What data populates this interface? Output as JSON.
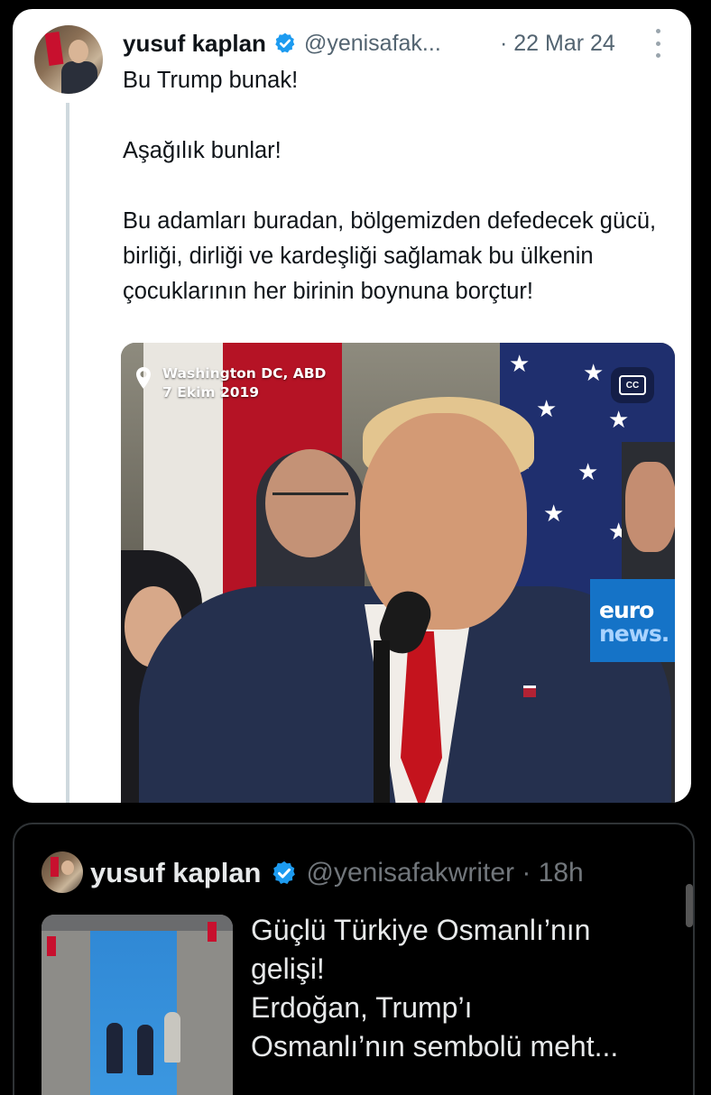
{
  "tweet": {
    "author_name": "yusuf kaplan",
    "handle": "@yenisafak...",
    "timestamp": "· 22 Mar 24",
    "paragraphs": [
      "Bu Trump bunak!",
      "Aşağılık bunlar!",
      "Bu adamları buradan, bölgemizden defedecek gücü, birliği, dirliği ve kardeşliği sağlamak bu ülkenin çocuklarının her birinin boynuna borçtur!"
    ],
    "video": {
      "location": "Washington DC, ABD",
      "date": "7 Ekim 2019",
      "cc_label": "CC",
      "logo_line1": "euro",
      "logo_line2": "news."
    }
  },
  "quoted": {
    "author_name": "yusuf kaplan",
    "handle": "@yenisafakwriter · 18h",
    "lines": [
      "Güçlü Türkiye Osmanlı’nın",
      "gelişi!",
      "Erdoğan, Trump’ı",
      "Osmanlı’nın sembolü meht..."
    ]
  },
  "colors": {
    "verified": "#1d9bf0",
    "light_text": "#0f1419",
    "light_secondary": "#536471",
    "dark_text": "#e7e9ea",
    "dark_secondary": "#71767b"
  },
  "icons": [
    "verified-badge-icon",
    "more-options-icon",
    "location-pin-icon",
    "closed-captions-icon"
  ]
}
